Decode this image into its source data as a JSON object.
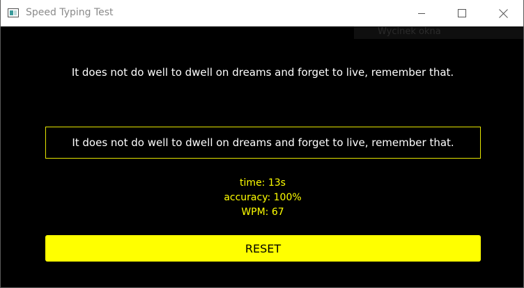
{
  "window": {
    "title": "Speed Typing Test",
    "icon": "app-window-icon",
    "controls": {
      "minimize_icon": "minimize-icon",
      "maximize_icon": "maximize-icon",
      "close_icon": "close-icon"
    }
  },
  "overlay": {
    "snip_label": "Wycinek okna"
  },
  "test": {
    "sentence": "It does not do well to dwell on dreams and forget to live, remember that.",
    "typed_text": "It does not do well to dwell on dreams and forget to live, remember that."
  },
  "stats": {
    "time": "time: 13s",
    "accuracy": "accuracy: 100%",
    "wpm": "WPM: 67"
  },
  "controls": {
    "reset_label": "RESET"
  },
  "colors": {
    "background": "#000000",
    "accent": "#ffff00",
    "text": "#ffffff",
    "titlebar": "#ffffff"
  }
}
